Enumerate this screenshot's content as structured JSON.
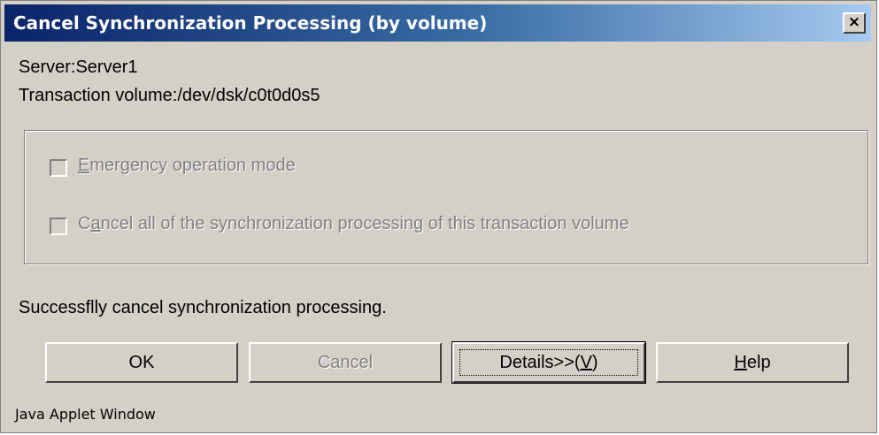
{
  "window": {
    "title": "Cancel Synchronization Processing (by volume)",
    "close_glyph": "×",
    "close_icon": "close-icon"
  },
  "info": {
    "server": "Server:Server1",
    "transaction_volume": "Transaction volume:/dev/dsk/c0t0d0s5"
  },
  "options": [
    {
      "label": "Emergency operation mode",
      "mnemonic_index": 0,
      "checked": false,
      "enabled": false
    },
    {
      "label": "Cancel all of the synchronization processing of this transaction volume",
      "mnemonic_index": 1,
      "checked": false,
      "enabled": false
    }
  ],
  "status": {
    "message": "Successflly cancel synchronization processing."
  },
  "buttons": {
    "ok": "OK",
    "cancel": "Cancel",
    "details_prefix": "Details>>(",
    "details_mnemonic": "V",
    "details_suffix": ")",
    "help_mnemonic": "H",
    "help_rest": "elp"
  },
  "footer": {
    "text": "Java Applet Window"
  },
  "colors": {
    "title_gradient_start": "#0a246a",
    "title_gradient_end": "#a6caf0",
    "dialog_face": "#d4d0c8",
    "disabled_text": "#808080"
  }
}
